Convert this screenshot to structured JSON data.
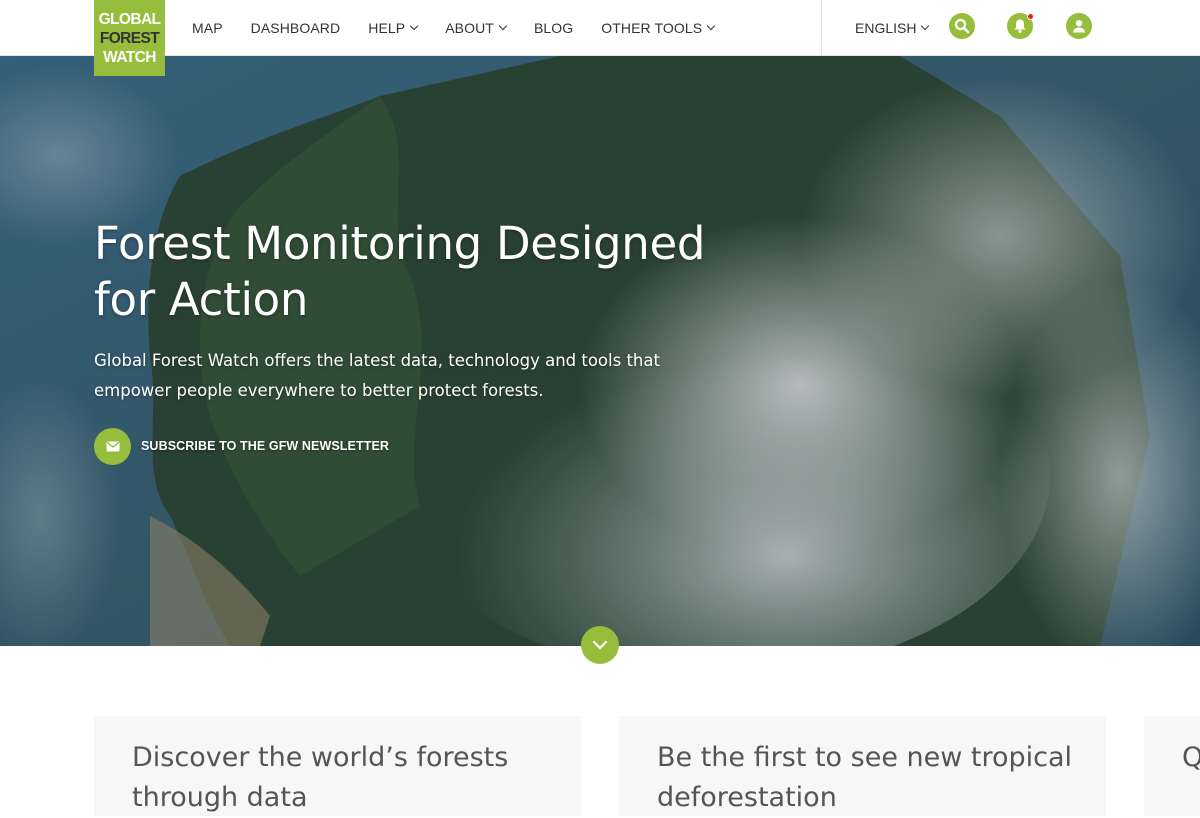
{
  "logo": {
    "line1": "GLOBAL",
    "line2": "FOREST",
    "line3": "WATCH"
  },
  "nav": {
    "items": [
      {
        "label": "MAP",
        "dropdown": false
      },
      {
        "label": "DASHBOARD",
        "dropdown": false
      },
      {
        "label": "HELP",
        "dropdown": true
      },
      {
        "label": "ABOUT",
        "dropdown": true
      },
      {
        "label": "BLOG",
        "dropdown": false
      },
      {
        "label": "OTHER TOOLS",
        "dropdown": true
      }
    ],
    "language": "ENGLISH"
  },
  "icons": {
    "search": "search-icon",
    "notifications": "bell-icon",
    "account": "user-icon"
  },
  "hero": {
    "title": "Forest Monitoring Designed for Action",
    "subtitle": "Global Forest Watch offers the latest data, technology and tools that empower people everywhere to better protect forests.",
    "subscribe_label": "SUBSCRIBE TO THE GFW NEWSLETTER"
  },
  "cards": [
    {
      "title": "Discover the world’s forests through data"
    },
    {
      "title": "Be the first to see new tropical deforestation"
    },
    {
      "title": "Q"
    }
  ],
  "colors": {
    "brand_green": "#97bd3d",
    "notification_red": "#e0281d",
    "text_dark": "#333333"
  }
}
